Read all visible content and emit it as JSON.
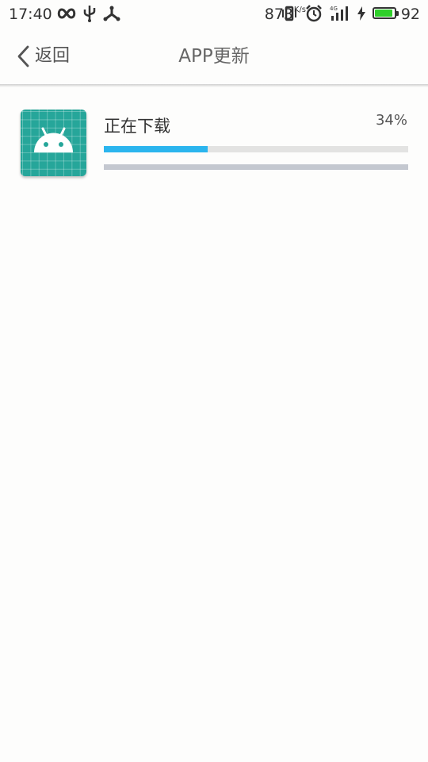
{
  "status_bar": {
    "time": "17:40",
    "net_speed": "873",
    "net_speed_unit": "K/s",
    "battery_level": "92",
    "battery_fill_fraction": 0.92,
    "battery_color": "#2fcf2a",
    "icons": [
      "infinity-icon",
      "usb-icon",
      "share-icon",
      "vibrate-icon",
      "alarm-icon",
      "signal-4g-icon",
      "charging-icon",
      "battery-icon"
    ]
  },
  "header": {
    "back_label": "返回",
    "title": "APP更新"
  },
  "download": {
    "app_icon": "android-app-icon",
    "status": "正在下载",
    "percent_label": "34%",
    "progress_fraction": 0.34,
    "progress_color": "#2bb5ee"
  }
}
